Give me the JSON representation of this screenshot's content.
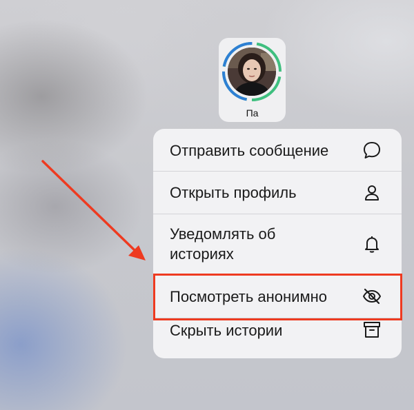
{
  "story": {
    "name": "Па",
    "ring_colors": [
      "#3fbf7f",
      "#2e7fd4"
    ]
  },
  "menu": {
    "items": [
      {
        "label": "Отправить сообщение",
        "icon": "message-bubble-icon"
      },
      {
        "label": "Открыть профиль",
        "icon": "person-icon"
      },
      {
        "label_line1": "Уведомлять об",
        "label_line2": "историях",
        "icon": "bell-icon"
      },
      {
        "label": "Посмотреть анонимно",
        "icon": "eye-slash-icon"
      },
      {
        "label": "Скрыть истории",
        "icon": "archive-box-icon"
      }
    ]
  },
  "annotation": {
    "highlight_color": "#ee3a20",
    "highlighted_item": "Посмотреть анонимно"
  }
}
